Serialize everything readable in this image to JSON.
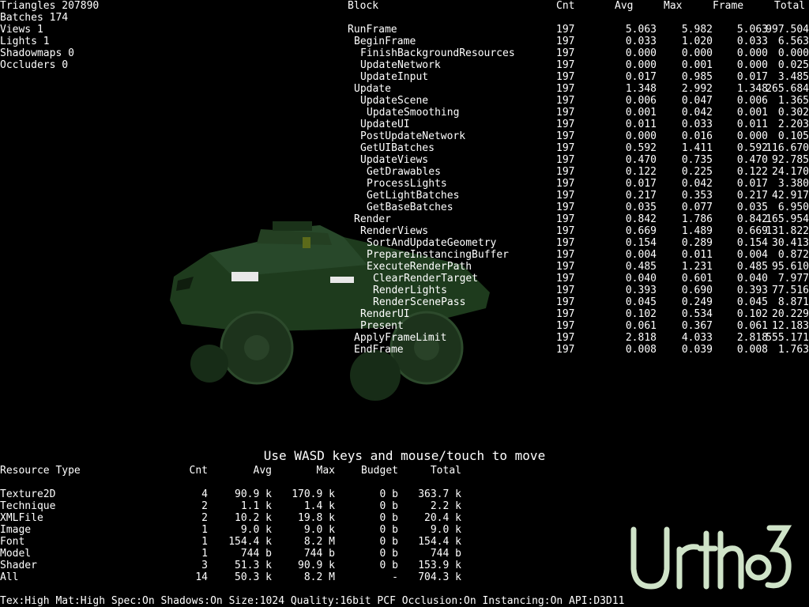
{
  "stats": [
    "Triangles 207890",
    "Batches 174",
    "Views 1",
    "Lights 1",
    "Shadowmaps 0",
    "Occluders 0"
  ],
  "profiler": {
    "headers": [
      "Block",
      "Cnt",
      "Avg",
      "Max",
      "Frame",
      "Total"
    ],
    "rows": [
      {
        "name": "RunFrame",
        "cnt": "197",
        "avg": "5.063",
        "max": "5.982",
        "frame": "5.063",
        "total": "997.504",
        "depth": 0
      },
      {
        "name": "BeginFrame",
        "cnt": "197",
        "avg": "0.033",
        "max": "1.020",
        "frame": "0.033",
        "total": "6.563",
        "depth": 1
      },
      {
        "name": "FinishBackgroundResources",
        "cnt": "197",
        "avg": "0.000",
        "max": "0.000",
        "frame": "0.000",
        "total": "0.000",
        "depth": 2
      },
      {
        "name": "UpdateNetwork",
        "cnt": "197",
        "avg": "0.000",
        "max": "0.001",
        "frame": "0.000",
        "total": "0.025",
        "depth": 2
      },
      {
        "name": "UpdateInput",
        "cnt": "197",
        "avg": "0.017",
        "max": "0.985",
        "frame": "0.017",
        "total": "3.485",
        "depth": 2
      },
      {
        "name": "Update",
        "cnt": "197",
        "avg": "1.348",
        "max": "2.992",
        "frame": "1.348",
        "total": "265.684",
        "depth": 1
      },
      {
        "name": "UpdateScene",
        "cnt": "197",
        "avg": "0.006",
        "max": "0.047",
        "frame": "0.006",
        "total": "1.365",
        "depth": 2
      },
      {
        "name": "UpdateSmoothing",
        "cnt": "197",
        "avg": "0.001",
        "max": "0.042",
        "frame": "0.001",
        "total": "0.302",
        "depth": 3
      },
      {
        "name": "UpdateUI",
        "cnt": "197",
        "avg": "0.011",
        "max": "0.033",
        "frame": "0.011",
        "total": "2.203",
        "depth": 2
      },
      {
        "name": "PostUpdateNetwork",
        "cnt": "197",
        "avg": "0.000",
        "max": "0.016",
        "frame": "0.000",
        "total": "0.105",
        "depth": 2
      },
      {
        "name": "GetUIBatches",
        "cnt": "197",
        "avg": "0.592",
        "max": "1.411",
        "frame": "0.592",
        "total": "116.670",
        "depth": 2
      },
      {
        "name": "UpdateViews",
        "cnt": "197",
        "avg": "0.470",
        "max": "0.735",
        "frame": "0.470",
        "total": "92.785",
        "depth": 2
      },
      {
        "name": "GetDrawables",
        "cnt": "197",
        "avg": "0.122",
        "max": "0.225",
        "frame": "0.122",
        "total": "24.170",
        "depth": 3
      },
      {
        "name": "ProcessLights",
        "cnt": "197",
        "avg": "0.017",
        "max": "0.042",
        "frame": "0.017",
        "total": "3.380",
        "depth": 3
      },
      {
        "name": "GetLightBatches",
        "cnt": "197",
        "avg": "0.217",
        "max": "0.353",
        "frame": "0.217",
        "total": "42.917",
        "depth": 3
      },
      {
        "name": "GetBaseBatches",
        "cnt": "197",
        "avg": "0.035",
        "max": "0.077",
        "frame": "0.035",
        "total": "6.950",
        "depth": 3
      },
      {
        "name": "Render",
        "cnt": "197",
        "avg": "0.842",
        "max": "1.786",
        "frame": "0.842",
        "total": "165.954",
        "depth": 1
      },
      {
        "name": "RenderViews",
        "cnt": "197",
        "avg": "0.669",
        "max": "1.489",
        "frame": "0.669",
        "total": "131.822",
        "depth": 2
      },
      {
        "name": "SortAndUpdateGeometry",
        "cnt": "197",
        "avg": "0.154",
        "max": "0.289",
        "frame": "0.154",
        "total": "30.413",
        "depth": 3
      },
      {
        "name": "PrepareInstancingBuffer",
        "cnt": "197",
        "avg": "0.004",
        "max": "0.011",
        "frame": "0.004",
        "total": "0.872",
        "depth": 3
      },
      {
        "name": "ExecuteRenderPath",
        "cnt": "197",
        "avg": "0.485",
        "max": "1.231",
        "frame": "0.485",
        "total": "95.610",
        "depth": 3
      },
      {
        "name": "ClearRenderTarget",
        "cnt": "197",
        "avg": "0.040",
        "max": "0.601",
        "frame": "0.040",
        "total": "7.977",
        "depth": 4
      },
      {
        "name": "RenderLights",
        "cnt": "197",
        "avg": "0.393",
        "max": "0.690",
        "frame": "0.393",
        "total": "77.516",
        "depth": 4
      },
      {
        "name": "RenderScenePass",
        "cnt": "197",
        "avg": "0.045",
        "max": "0.249",
        "frame": "0.045",
        "total": "8.871",
        "depth": 4
      },
      {
        "name": "RenderUI",
        "cnt": "197",
        "avg": "0.102",
        "max": "0.534",
        "frame": "0.102",
        "total": "20.229",
        "depth": 2
      },
      {
        "name": "Present",
        "cnt": "197",
        "avg": "0.061",
        "max": "0.367",
        "frame": "0.061",
        "total": "12.183",
        "depth": 2
      },
      {
        "name": "ApplyFrameLimit",
        "cnt": "197",
        "avg": "2.818",
        "max": "4.033",
        "frame": "2.818",
        "total": "555.171",
        "depth": 1
      },
      {
        "name": "EndFrame",
        "cnt": "197",
        "avg": "0.008",
        "max": "0.039",
        "frame": "0.008",
        "total": "1.763",
        "depth": 1
      }
    ]
  },
  "hint": "Use WASD keys and mouse/touch to move",
  "resources": {
    "headers": [
      "Resource Type",
      "Cnt",
      "Avg",
      "Max",
      "Budget",
      "Total"
    ],
    "rows": [
      {
        "type": "Texture2D",
        "cnt": "4",
        "avg": "90.9 k",
        "max": "170.9 k",
        "budget": "0 b",
        "total": "363.7 k"
      },
      {
        "type": "Technique",
        "cnt": "2",
        "avg": "1.1 k",
        "max": "1.4 k",
        "budget": "0 b",
        "total": "2.2 k"
      },
      {
        "type": "XMLFile",
        "cnt": "2",
        "avg": "10.2 k",
        "max": "19.8 k",
        "budget": "0 b",
        "total": "20.4 k"
      },
      {
        "type": "Image",
        "cnt": "1",
        "avg": "9.0 k",
        "max": "9.0 k",
        "budget": "0 b",
        "total": "9.0 k"
      },
      {
        "type": "Font",
        "cnt": "1",
        "avg": "154.4 k",
        "max": "8.2 M",
        "budget": "0 b",
        "total": "154.4 k"
      },
      {
        "type": "Model",
        "cnt": "1",
        "avg": "744 b",
        "max": "744 b",
        "budget": "0 b",
        "total": "744 b"
      },
      {
        "type": "Shader",
        "cnt": "3",
        "avg": "51.3 k",
        "max": "90.9 k",
        "budget": "0 b",
        "total": "153.9 k"
      },
      {
        "type": "All",
        "cnt": "14",
        "avg": "50.3 k",
        "max": "8.2 M",
        "budget": "-",
        "total": "704.3 k"
      }
    ]
  },
  "footer": "Tex:High Mat:High Spec:On Shadows:On Size:1024 Quality:16bit PCF Occlusion:On Instancing:On API:D3D11",
  "logo": {
    "text": "Urho3D"
  },
  "colors": {
    "background": "#000000",
    "text": "#ffffff",
    "vehicle": "#1f3a1c",
    "logo": "#cfe3c8"
  }
}
